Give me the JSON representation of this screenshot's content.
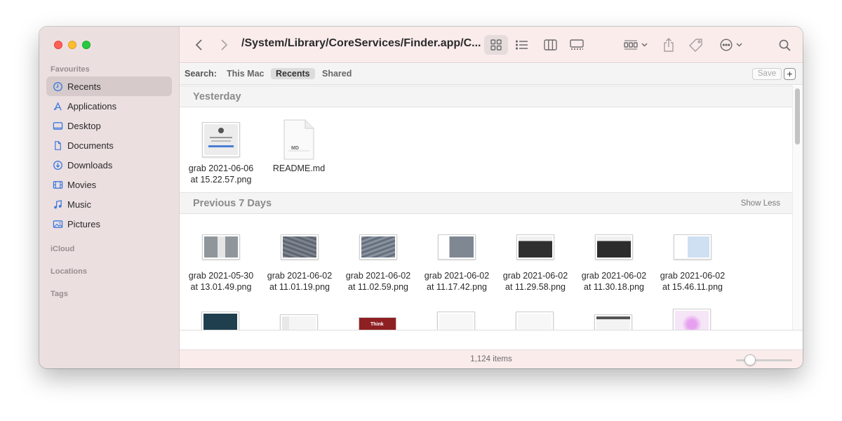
{
  "sidebar": {
    "favourites_label": "Favourites",
    "items": [
      {
        "label": "Recents",
        "icon": "clock-icon",
        "selected": true
      },
      {
        "label": "Applications",
        "icon": "applications-icon"
      },
      {
        "label": "Desktop",
        "icon": "desktop-icon"
      },
      {
        "label": "Documents",
        "icon": "document-icon"
      },
      {
        "label": "Downloads",
        "icon": "download-icon"
      },
      {
        "label": "Movies",
        "icon": "film-icon"
      },
      {
        "label": "Music",
        "icon": "music-note-icon"
      },
      {
        "label": "Pictures",
        "icon": "photo-icon"
      }
    ],
    "icloud_label": "iCloud",
    "locations_label": "Locations",
    "tags_label": "Tags"
  },
  "toolbar": {
    "title": "/System/Library/CoreServices/Finder.app/C...",
    "view_mode": "icons"
  },
  "scope": {
    "label": "Search:",
    "this_mac": "This Mac",
    "recents": "Recents",
    "shared": "Shared",
    "selected": "Recents",
    "save": "Save",
    "add": "+"
  },
  "groups": {
    "yesterday": {
      "title": "Yesterday",
      "files": [
        {
          "line1": "grab 2021-06-06",
          "line2": "at 15.22.57.png"
        },
        {
          "line1": "README.md",
          "line2": "",
          "badge": "MD"
        }
      ]
    },
    "previous": {
      "title": "Previous 7 Days",
      "show_less": "Show Less",
      "files": [
        {
          "line1": "grab 2021-05-30",
          "line2": "at 13.01.49.png"
        },
        {
          "line1": "grab 2021-06-02",
          "line2": "at 11.01.19.png"
        },
        {
          "line1": "grab 2021-06-02",
          "line2": "at 11.02.59.png"
        },
        {
          "line1": "grab 2021-06-02",
          "line2": "at 11.17.42.png"
        },
        {
          "line1": "grab 2021-06-02",
          "line2": "at 11.29.58.png"
        },
        {
          "line1": "grab 2021-06-02",
          "line2": "at 11.30.18.png"
        },
        {
          "line1": "grab 2021-06-02",
          "line2": "at 15.46.11.png"
        }
      ],
      "partial_thumb_text": "Think Tank"
    }
  },
  "status": {
    "item_count": "1,124 items",
    "icon_size_fraction": 0.25
  },
  "colors": {
    "close": "#fe5f57",
    "minimize": "#febc2e",
    "zoom": "#28c840",
    "sidebar_accent": "#3b7ae0"
  }
}
